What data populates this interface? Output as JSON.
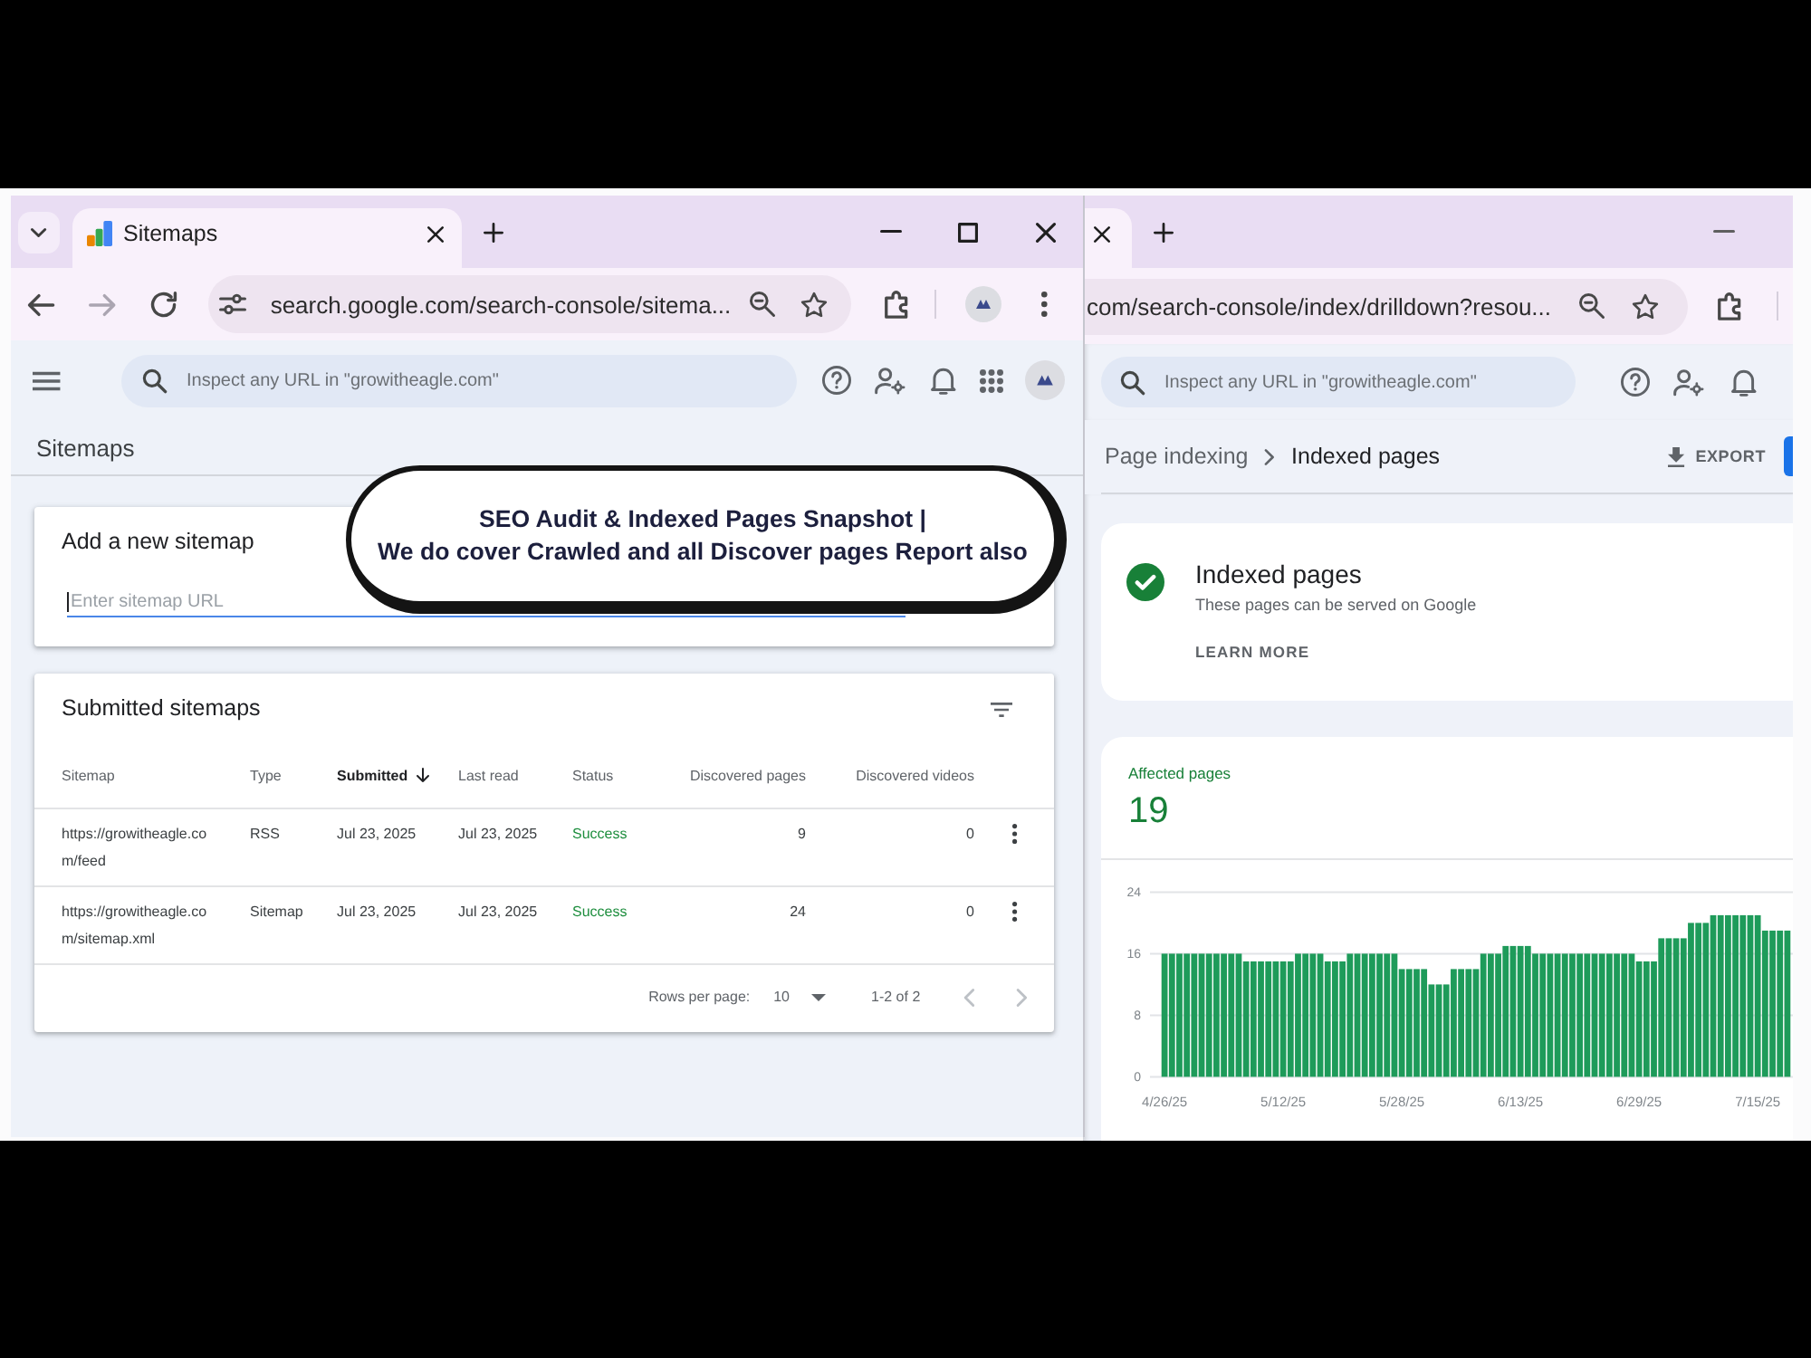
{
  "left_window": {
    "tabs": [
      {
        "title": "Sitemaps",
        "selected": true
      }
    ],
    "navigation": [
      {
        "kind": "back",
        "disabled": false
      },
      {
        "kind": "forward",
        "disabled": true
      },
      {
        "kind": "reload",
        "disabled": false
      }
    ],
    "address_bar": {
      "url": "search.google.com/search-console/sitema..."
    },
    "search": {
      "placeholder": "Inspect any URL in \"growitheagle.com\""
    },
    "page_title": "Sitemaps",
    "add_sitemap": {
      "title": "Add a new sitemap",
      "field": {
        "placeholder": "Enter sitemap URL",
        "focused": true
      }
    },
    "submitted_sitemaps": {
      "title": "Submitted sitemaps",
      "columns": [
        {
          "label": "Sitemap",
          "kind": "url",
          "sorted": false
        },
        {
          "label": "Type",
          "kind": "text",
          "sorted": false
        },
        {
          "label": "Submitted",
          "kind": "text",
          "sorted": true
        },
        {
          "label": "Last read",
          "kind": "text",
          "sorted": false
        },
        {
          "label": "Status",
          "kind": "status",
          "sorted": false
        },
        {
          "label": "Discovered pages",
          "kind": "number",
          "sorted": false
        },
        {
          "label": "Discovered videos",
          "kind": "number",
          "sorted": false
        }
      ],
      "rows": [
        {
          "cells": [
            "https://growitheagle.com/feed",
            "RSS",
            "Jul 23, 2025",
            "Jul 23, 2025",
            "Success",
            "9",
            "0"
          ]
        },
        {
          "cells": [
            "https://growitheagle.com/sitemap.xml",
            "Sitemap",
            "Jul 23, 2025",
            "Jul 23, 2025",
            "Success",
            "24",
            "0"
          ]
        }
      ],
      "pagination": {
        "rows_per_page_label": "Rows per page:",
        "rows_per_page": "10",
        "range": "1-2 of 2",
        "pager": [
          {
            "kind": "prev",
            "disabled": true
          },
          {
            "kind": "next",
            "disabled": true
          }
        ]
      }
    }
  },
  "right_window": {
    "tabs": [
      {
        "selected": true
      }
    ],
    "address_bar": {
      "url": "com/search-console/index/drilldown?resou..."
    },
    "search": {
      "placeholder": "Inspect any URL in \"growitheagle.com\""
    },
    "breadcrumb": [
      {
        "label": "Page indexing",
        "current": false
      },
      {
        "label": "Indexed pages",
        "current": true
      }
    ],
    "export_button": "EXPORT",
    "status_card": {
      "title": "Indexed pages",
      "description": "These pages can be served on Google",
      "link": "LEARN MORE"
    },
    "affected_pages": {
      "label": "Affected pages",
      "count": "19",
      "chart_data": {
        "type": "bar",
        "ylim": [
          0,
          24
        ],
        "yticks": [
          0,
          8,
          16,
          24
        ],
        "categories": [
          "4/26/25",
          null,
          null,
          null,
          null,
          null,
          null,
          null,
          null,
          null,
          null,
          null,
          null,
          null,
          null,
          null,
          "5/12/25",
          null,
          null,
          null,
          null,
          null,
          null,
          null,
          null,
          null,
          null,
          null,
          null,
          null,
          null,
          null,
          "5/28/25",
          null,
          null,
          null,
          null,
          null,
          null,
          null,
          null,
          null,
          null,
          null,
          null,
          null,
          null,
          null,
          "6/13/25",
          null,
          null,
          null,
          null,
          null,
          null,
          null,
          null,
          null,
          null,
          null,
          null,
          null,
          null,
          null,
          "6/29/25",
          null,
          null,
          null,
          null,
          null,
          null,
          null,
          null,
          null,
          null,
          null,
          null,
          null,
          null,
          null,
          "7/15/25",
          null,
          null,
          null,
          null
        ],
        "values": [
          16,
          16,
          16,
          16,
          16,
          16,
          16,
          16,
          16,
          16,
          16,
          15,
          15,
          15,
          15,
          15,
          15,
          15,
          16,
          16,
          16,
          16,
          15,
          15,
          15,
          16,
          16,
          16,
          16,
          16,
          16,
          16,
          14,
          14,
          14,
          14,
          12,
          12,
          12,
          14,
          14,
          14,
          14,
          16,
          16,
          16,
          17,
          17,
          17,
          17,
          16,
          16,
          16,
          16,
          16,
          16,
          16,
          16,
          16,
          16,
          16,
          16,
          16,
          16,
          15,
          15,
          15,
          18,
          18,
          18,
          18,
          20,
          20,
          20,
          21,
          21,
          21,
          21,
          21,
          21,
          21,
          19,
          19,
          19,
          19
        ]
      }
    }
  },
  "callout": {
    "lines": [
      "SEO Audit & Indexed Pages Snapshot |",
      "We do cover Crawled and all Discover pages Report also"
    ]
  }
}
